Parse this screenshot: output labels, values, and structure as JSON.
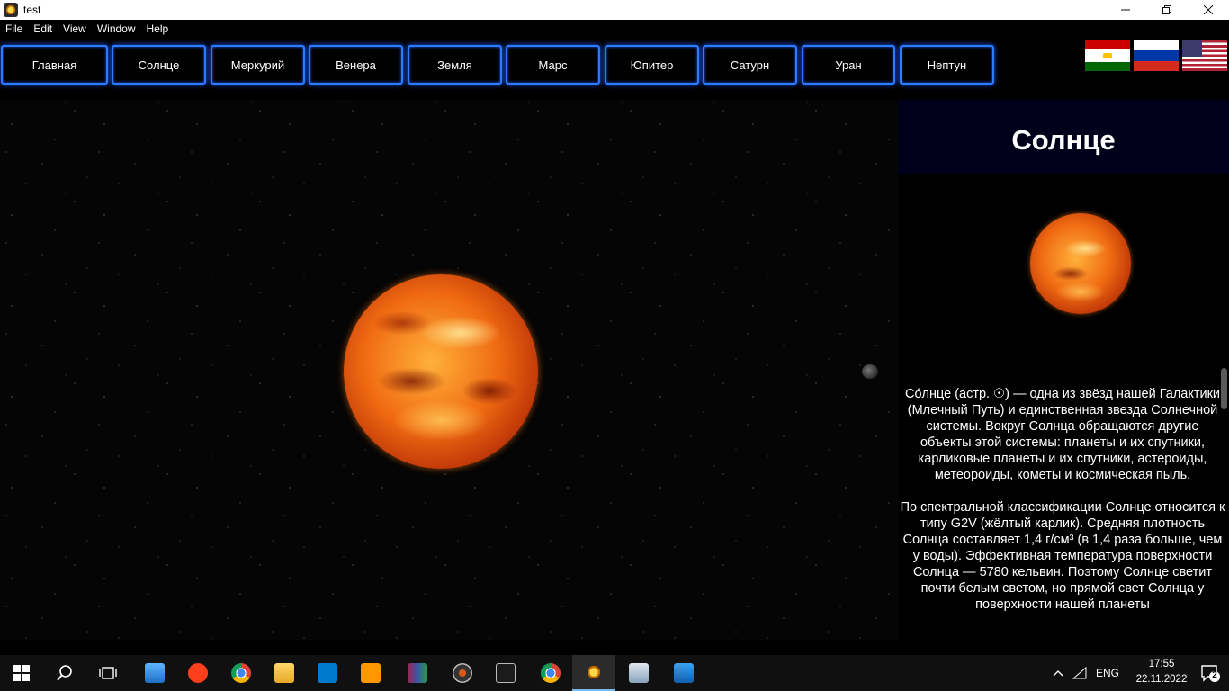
{
  "window": {
    "title": "test"
  },
  "menu": [
    "File",
    "Edit",
    "View",
    "Window",
    "Help"
  ],
  "nav": [
    "Главная",
    "Солнце",
    "Меркурий",
    "Венера",
    "Земля",
    "Марс",
    "Юпитер",
    "Сатурн",
    "Уран",
    "Нептун"
  ],
  "panel": {
    "title": "Солнце",
    "paragraphs": [
      "Со́лнце (астр. ☉) — одна из звёзд нашей Галактики (Млечный Путь) и единственная звезда Солнечной системы. Вокруг Солнца обращаются другие объекты этой системы: планеты и их спутники, карликовые планеты и их спутники, астероиды, метеороиды, кометы и космическая пыль.",
      "По спектральной классификации Солнце относится к типу G2V (жёлтый карлик). Средняя плотность Солнца составляет 1,4 г/см³ (в 1,4 раза больше, чем у воды). Эффективная температура поверхности Солнца — 5780 кельвин. Поэтому Солнце светит почти белым светом, но прямой свет Солнца у поверхности нашей планеты"
    ]
  },
  "flags": [
    "tajikistan-flag",
    "russia-flag",
    "usa-flag"
  ],
  "taskbar": {
    "language": "ENG",
    "time": "17:55",
    "date": "22.11.2022",
    "notifications": "2"
  },
  "colors": {
    "nav_border": "#2d7cff",
    "panel_head_bg": "#00001a"
  }
}
